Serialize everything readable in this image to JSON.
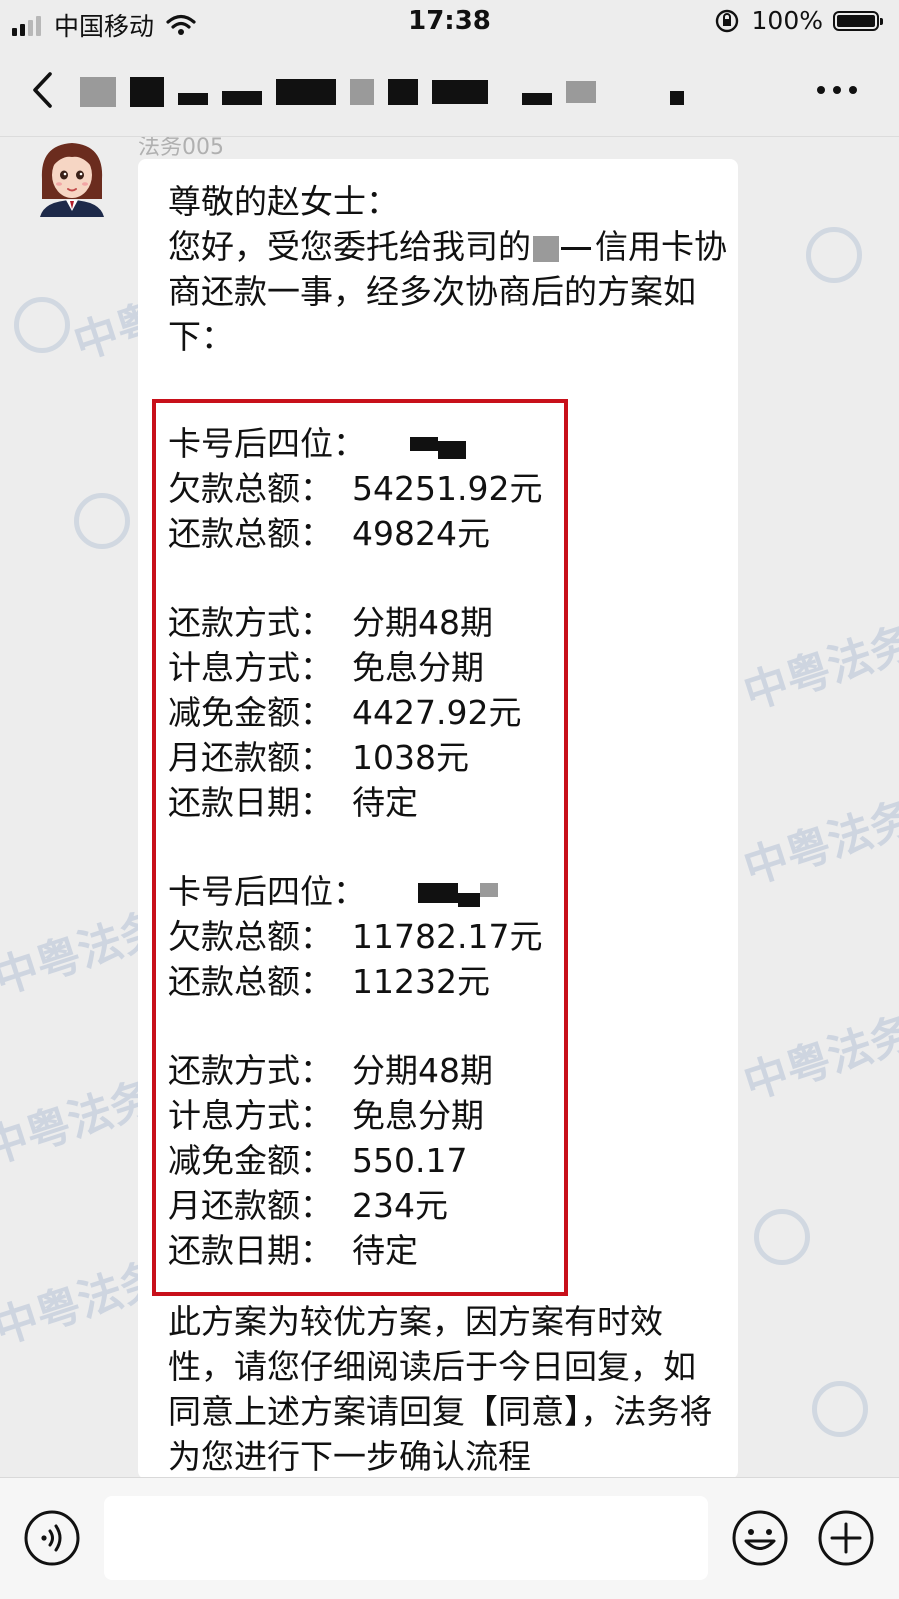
{
  "status_bar": {
    "carrier": "中国移动",
    "time": "17:38",
    "battery": "100%"
  },
  "chat": {
    "sender_name": "法务005",
    "greeting": "尊敬的赵女士：",
    "intro": "您好，受您委托给我司的",
    "intro_suffix": "信用卡协商还款一事，经多次协商后的方案如下：",
    "plans": [
      {
        "card_label": "卡号后四位：",
        "debt_label": "欠款总额：",
        "debt_value": "54251.92元",
        "repay_label": "还款总额：",
        "repay_value": "49824元",
        "method_label": "还款方式：",
        "method_value": "分期48期",
        "interest_label": "计息方式：",
        "interest_value": "免息分期",
        "reduce_label": "减免金额：",
        "reduce_value": "4427.92元",
        "monthly_label": "月还款额：",
        "monthly_value": "1038元",
        "date_label": "还款日期：",
        "date_value": "待定"
      },
      {
        "card_label": "卡号后四位：",
        "debt_label": "欠款总额：",
        "debt_value": "11782.17元",
        "repay_label": "还款总额：",
        "repay_value": "11232元",
        "method_label": "还款方式：",
        "method_value": "分期48期",
        "interest_label": "计息方式：",
        "interest_value": "免息分期",
        "reduce_label": "减免金额：",
        "reduce_value": "550.17",
        "monthly_label": "月还款额：",
        "monthly_value": "234元",
        "date_label": "还款日期：",
        "date_value": "待定"
      }
    ],
    "closing": "此方案为较优方案，因方案有时效性，请您仔细阅读后于今日回复，如同意上述方案请回复【同意】，法务将为您进行下一步确认流程",
    "watermark": "中粤法务"
  },
  "input_bar": {
    "placeholder": ""
  }
}
